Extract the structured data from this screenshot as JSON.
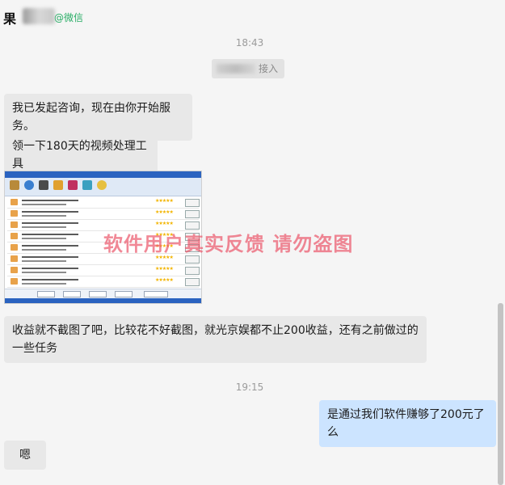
{
  "header": {
    "name": "果",
    "wechat_label": "@微信"
  },
  "timestamps": [
    "18:43",
    "19:15"
  ],
  "system_message": "接入",
  "messages": [
    {
      "side": "left",
      "text": "我已发起咨询，现在由你开始服务。"
    },
    {
      "side": "left",
      "text": "领一下180天的视频处理工具"
    },
    {
      "side": "left",
      "text": "收益就不截图了吧，比较花不好截图，就光京娱都不止200收益，还有之前做过的一些任务"
    },
    {
      "side": "right",
      "text": "是通过我们软件赚够了200元了么"
    },
    {
      "side": "left",
      "text": "嗯"
    }
  ],
  "watermark": "软件用户真实反馈  请勿盗图",
  "colors": {
    "bubble_left": "#e8e8e8",
    "bubble_right": "#cce4ff",
    "wechat_green": "#2aae67",
    "watermark": "#ec5a6e"
  }
}
